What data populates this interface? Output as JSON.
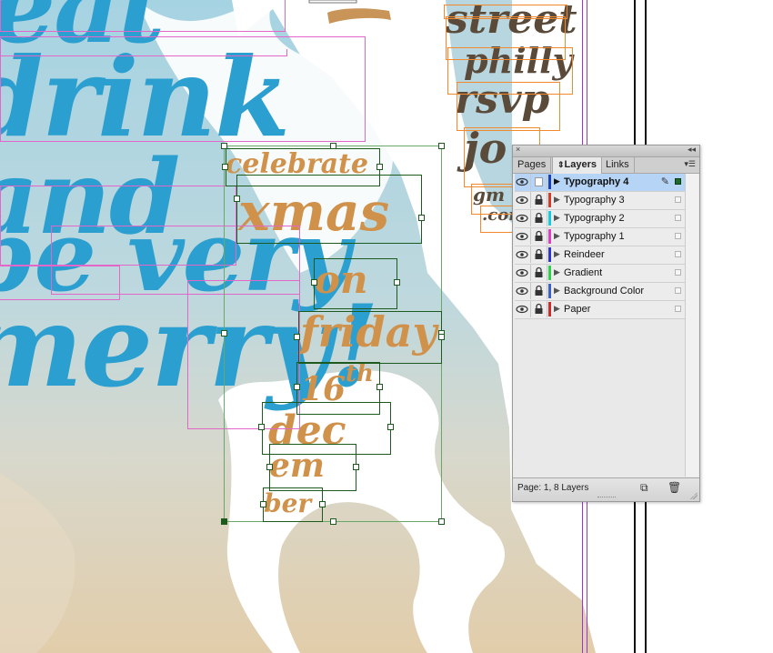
{
  "artwork": {
    "headline_lines": [
      "eat",
      "drink",
      "and",
      "be very",
      "merry!"
    ],
    "event_lines": [
      "celebrate",
      "xmas",
      "on",
      "friday",
      "16",
      "th",
      "dec",
      "em",
      "ber"
    ],
    "venue_lines": [
      "street",
      "philly",
      "rsvp",
      "jo",
      "gm",
      ".com"
    ]
  },
  "panel": {
    "tabs": [
      "Pages",
      "Layers",
      "Links"
    ],
    "active_tab": "Layers",
    "collapse_icon": "double-chevron-icon",
    "close_icon": "close-icon",
    "menu_icon": "panel-menu-icon",
    "layers": [
      {
        "name": "Typography 4",
        "color": "#1f3fb8",
        "selected": true,
        "visible": true,
        "locked": false
      },
      {
        "name": "Typography 3",
        "color": "#d63a2a",
        "selected": false,
        "visible": true,
        "locked": true
      },
      {
        "name": "Typography 2",
        "color": "#17c9e8",
        "selected": false,
        "visible": true,
        "locked": true
      },
      {
        "name": "Typography 1",
        "color": "#e23ec1",
        "selected": false,
        "visible": true,
        "locked": true
      },
      {
        "name": "Reindeer",
        "color": "#2d33d6",
        "selected": false,
        "visible": true,
        "locked": true
      },
      {
        "name": "Gradient",
        "color": "#2fd14a",
        "selected": false,
        "visible": true,
        "locked": true
      },
      {
        "name": "Background Color",
        "color": "#3a5fd1",
        "selected": false,
        "visible": true,
        "locked": true
      },
      {
        "name": "Paper",
        "color": "#d22a2a",
        "selected": false,
        "visible": true,
        "locked": true
      }
    ],
    "status": "Page: 1, 8 Layers",
    "new_layer_icon": "new-layer-icon",
    "delete_icon": "trash-icon"
  }
}
